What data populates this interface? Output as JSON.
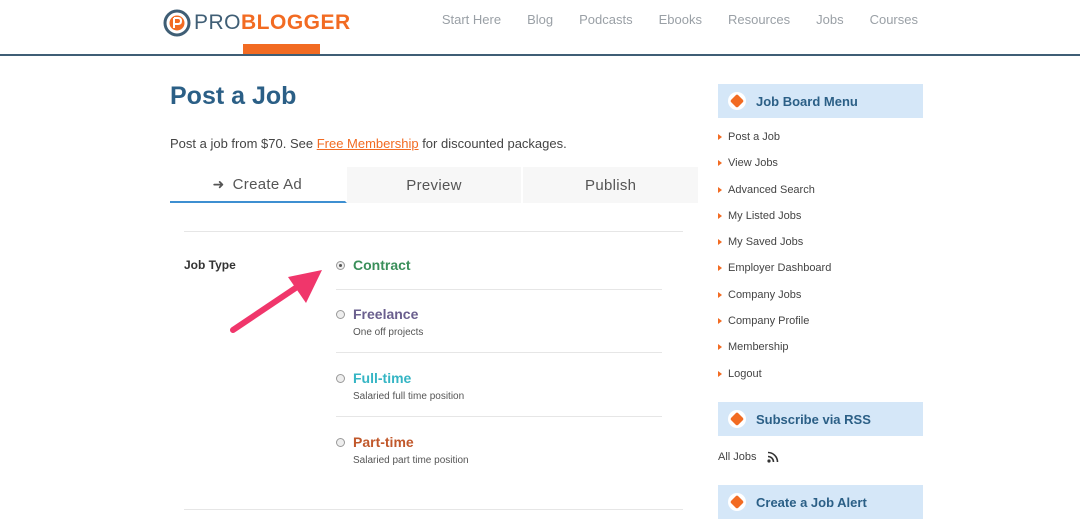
{
  "header": {
    "logo_pro": "PRO",
    "logo_blogger": "BLOGGER",
    "nav": [
      "Start Here",
      "Blog",
      "Podcasts",
      "Ebooks",
      "Resources",
      "Jobs",
      "Courses"
    ]
  },
  "colors": {
    "brand_orange": "#f26b22",
    "brand_blue": "#2b5f86",
    "contract": "#3a8f5a",
    "freelance": "#6a5f8e",
    "fulltime": "#35b5c4",
    "parttime": "#c1582b",
    "annotation": "#f0366b"
  },
  "main": {
    "title": "Post a Job",
    "intro_before": "Post a job from $70. See ",
    "intro_link": "Free Membership",
    "intro_after": " for discounted packages.",
    "steps": [
      {
        "label": "Create Ad",
        "active": true,
        "icon": "arrow-right-icon"
      },
      {
        "label": "Preview",
        "active": false
      },
      {
        "label": "Publish",
        "active": false
      }
    ],
    "job_type_label": "Job Type",
    "job_types": [
      {
        "title": "Contract",
        "desc": "",
        "checked": true
      },
      {
        "title": "Freelance",
        "desc": "One off projects",
        "checked": false
      },
      {
        "title": "Full-time",
        "desc": "Salaried full time position",
        "checked": false
      },
      {
        "title": "Part-time",
        "desc": "Salaried part time position",
        "checked": false
      }
    ]
  },
  "sidebar": {
    "menu_title": "Job Board Menu",
    "menu_items": [
      "Post a Job",
      "View Jobs",
      "Advanced Search",
      "My Listed Jobs",
      "My Saved Jobs",
      "Employer Dashboard",
      "Company Jobs",
      "Company Profile",
      "Membership",
      "Logout"
    ],
    "rss_title": "Subscribe via RSS",
    "rss_link": "All Jobs",
    "alert_title": "Create a Job Alert"
  }
}
